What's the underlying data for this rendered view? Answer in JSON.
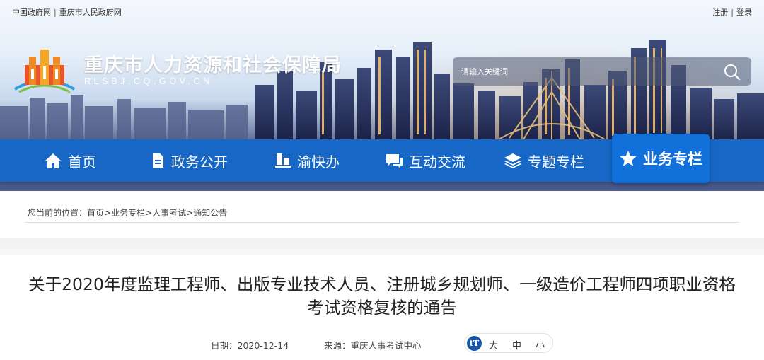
{
  "topbar": {
    "left_links": [
      "中国政府网",
      "重庆市人民政府网"
    ],
    "separator": "|",
    "right_links": [
      "注册",
      "登录"
    ]
  },
  "header": {
    "title": "重庆市人力资源和社会保障局",
    "domain": "RLSBJ.CQ.GOV.CN",
    "search_placeholder": "请输入关键词",
    "logo_icon": "emblem-icon"
  },
  "nav": {
    "items": [
      {
        "label": "首页",
        "icon": "home-icon"
      },
      {
        "label": "政务公开",
        "icon": "document-icon"
      },
      {
        "label": "渝快办",
        "icon": "desk-icon"
      },
      {
        "label": "互动交流",
        "icon": "chat-icon"
      },
      {
        "label": "专题专栏",
        "icon": "layers-icon"
      },
      {
        "label": "业务专栏",
        "icon": "star-icon",
        "active": true
      }
    ],
    "colors": {
      "bar": "#1667c6",
      "active": "#1270db"
    }
  },
  "breadcrumb": {
    "prefix": "您当前的位置：",
    "items": [
      "首页",
      "业务专栏",
      "人事考试",
      "通知公告"
    ],
    "separator": ">"
  },
  "article": {
    "title": "关于2020年度监理工程师、出版专业技术人员、注册城乡规划师、一级造价工程师四项职业资格考试资格复核的通告",
    "date_label": "日期：",
    "date": "2020-12-14",
    "source_label": "来源：",
    "source": "重庆人事考试中心",
    "font_size": {
      "icon": "tT",
      "options": [
        "大",
        "中",
        "小"
      ]
    }
  }
}
